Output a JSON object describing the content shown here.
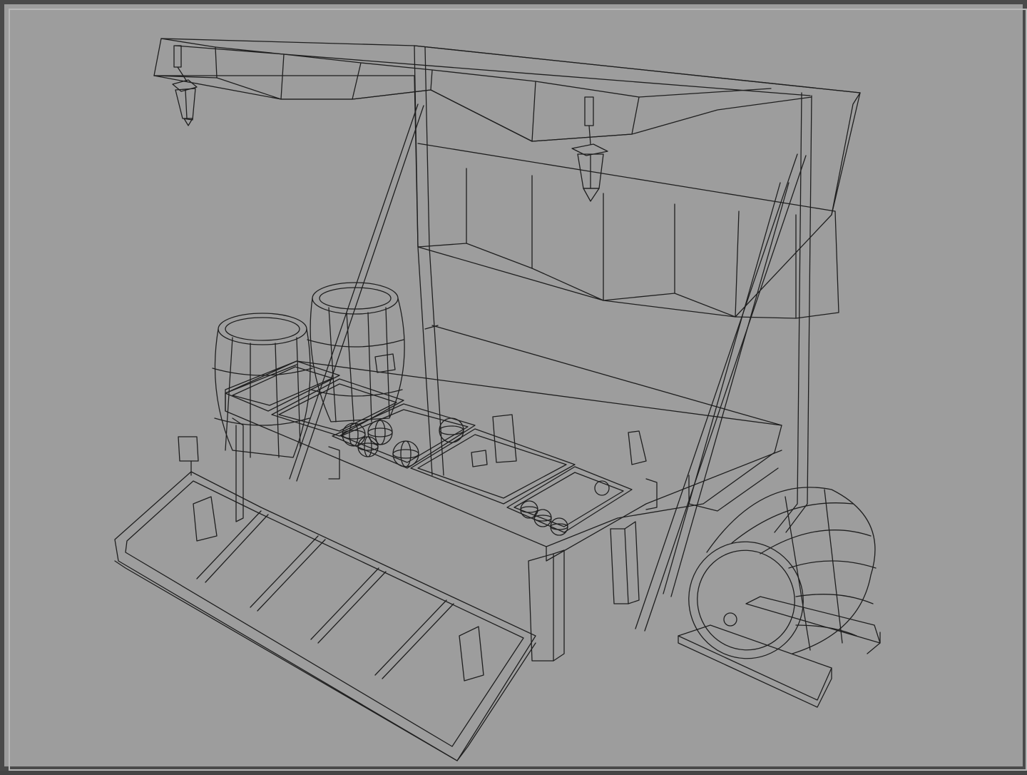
{
  "viewport": {
    "background_color": "#9d9d9d",
    "frame_color": "#4a4a4a",
    "wire_color": "#1e1e1e"
  },
  "scene": {
    "objects": [
      "market-stall-awning",
      "hanging-lantern-left",
      "hanging-lantern-right",
      "support-posts",
      "cloth-backdrop",
      "counter-table",
      "barrel-upright-left",
      "barrel-upright-right",
      "fruit-crates",
      "spheres-fruit",
      "sign-board",
      "display-tray-front",
      "barrel-lying-on-stand"
    ]
  }
}
